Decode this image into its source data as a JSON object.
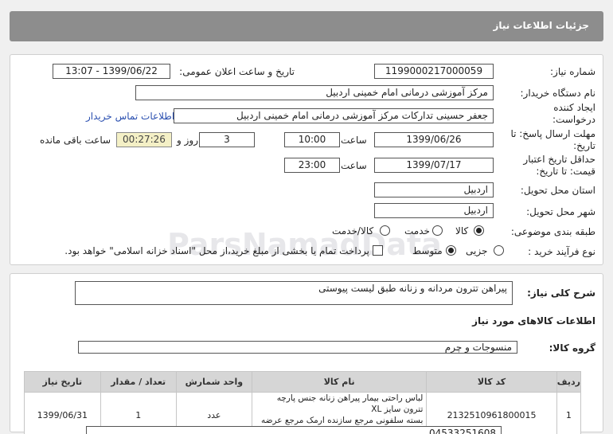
{
  "header": {
    "title": "جزئیات اطلاعات نیاز"
  },
  "form": {
    "need_number_label": "شماره نیاز:",
    "need_number": "1199000217000059",
    "announce_label": "تاریخ و ساعت اعلان عمومی:",
    "announce_value": "1399/06/22 - 13:07",
    "buyer_label": "نام دستگاه خریدار:",
    "buyer_value": "مرکز آموزشی درمانی امام خمینی اردبیل",
    "creator_label": "ایجاد کننده درخواست:",
    "creator_value": "جعفر حسینی تدارکات  مرکز آموزشی درمانی امام خمینی اردبیل",
    "contact_link": "اطلاعات تماس خریدار",
    "deadline_label": "مهلت ارسال پاسخ: تا تاریخ:",
    "deadline_date": "1399/06/26",
    "time_label": "ساعت",
    "deadline_time": "10:00",
    "days_value": "3",
    "days_label": "روز و",
    "remaining_value": "00:27:26",
    "remaining_label": "ساعت باقی مانده",
    "validity_label": "حداقل تاریخ اعتبار قیمت: تا تاریخ:",
    "validity_date": "1399/07/17",
    "validity_time": "23:00",
    "province_label": "استان محل تحویل:",
    "province_value": "اردبیل",
    "city_label": "شهر محل تحویل:",
    "city_value": "اردبیل",
    "category_label": "طبقه بندی موضوعی:",
    "category_options": [
      "کالا",
      "خدمت",
      "کالا/خدمت"
    ],
    "category_selected": "کالا",
    "process_label": "نوع فرآیند خرید :",
    "process_options": [
      "جزیی",
      "متوسط"
    ],
    "process_selected": "متوسط",
    "payment_note": "پرداخت تمام یا بخشی از مبلغ خرید،از محل \"اسناد خزانه اسلامی\" خواهد بود."
  },
  "description": {
    "label": "شرح کلی نیاز:",
    "value": "پیراهن تترون مردانه و زنانه طبق لیست پیوستی"
  },
  "goods": {
    "section_title": "اطلاعات کالاهای مورد نیاز",
    "group_label": "گروه کالا:",
    "group_value": "منسوجات و چرم",
    "columns": [
      "ردیف",
      "کد کالا",
      "نام کالا",
      "واحد شمارش",
      "تعداد / مقدار",
      "تاریخ نیاز"
    ],
    "rows": [
      {
        "index": "1",
        "code": "2132510961800015",
        "name_line1": "لباس راحتی بیمار پیراهن زنانه جنس پارچه تترون سایز XL",
        "name_line2": "بسته سلفونی مرجع سازنده ارمک مرجع عرضه کننده ارمک",
        "unit": "عدد",
        "qty": "1",
        "date": "1399/06/31"
      }
    ]
  },
  "footer_partial": "04533251608 "
}
